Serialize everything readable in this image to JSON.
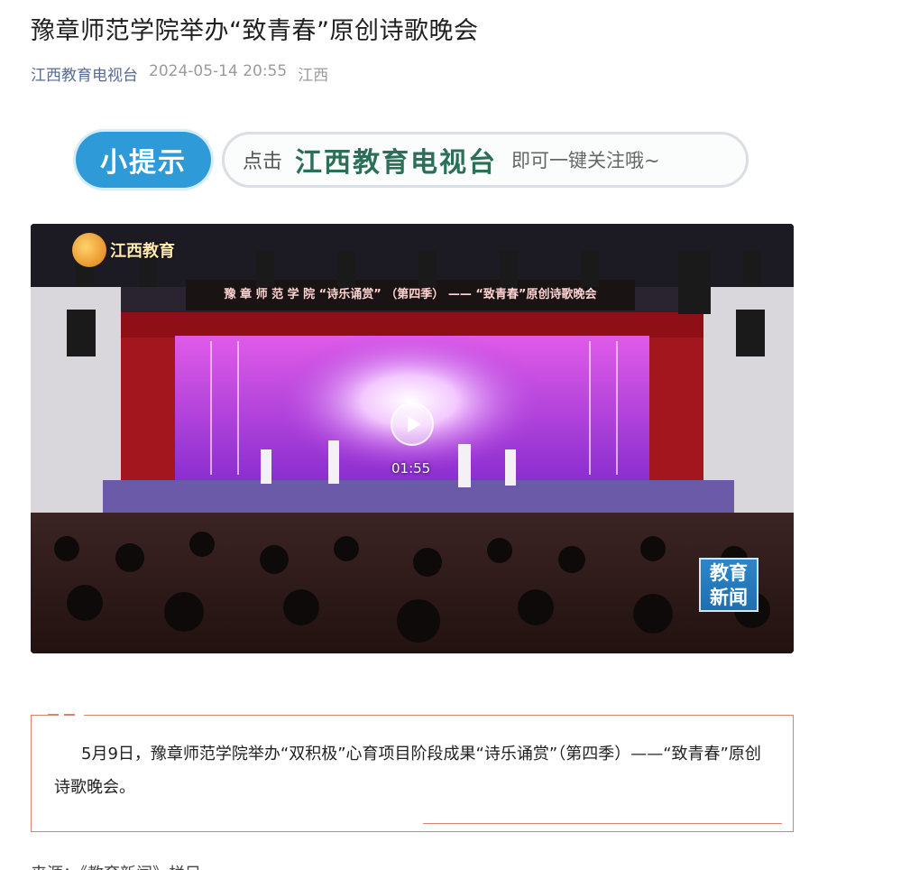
{
  "article": {
    "title": "豫章师范学院举办“致青春”原创诗歌晚会",
    "account": "江西教育电视台",
    "date": "2024-05-14 20:55",
    "region": "江西"
  },
  "tip_banner": {
    "badge": "小提示",
    "click": "点击",
    "name": "江西教育电视台",
    "tail": "即可一键关注哦~"
  },
  "video": {
    "duration": "01:55",
    "station_logo": "江西教育",
    "stage_banner": "豫 章 师 范 学 院 “诗乐诵赏” （第四季） —— “致青春”原创诗歌晚会",
    "corner_badge_line1": "教育",
    "corner_badge_line2": "新闻",
    "play_icon": "play-icon",
    "colors": {
      "stage": "#c43bd6",
      "curtain": "#b21c22",
      "seats": "#6b2a25"
    }
  },
  "body": {
    "paragraph": "5月9日，豫章师范学院举办“双积极”心育项目阶段成果“诗乐诵赏”（第四季）——“致青春”原创诗歌晚会。",
    "source_cut": "来源：《教育新闻》栏目"
  },
  "colors": {
    "accent_link": "#576b95",
    "frame": "#d9826d",
    "tip_blue": "#2f9ad8",
    "tip_green": "#2b6f57"
  }
}
